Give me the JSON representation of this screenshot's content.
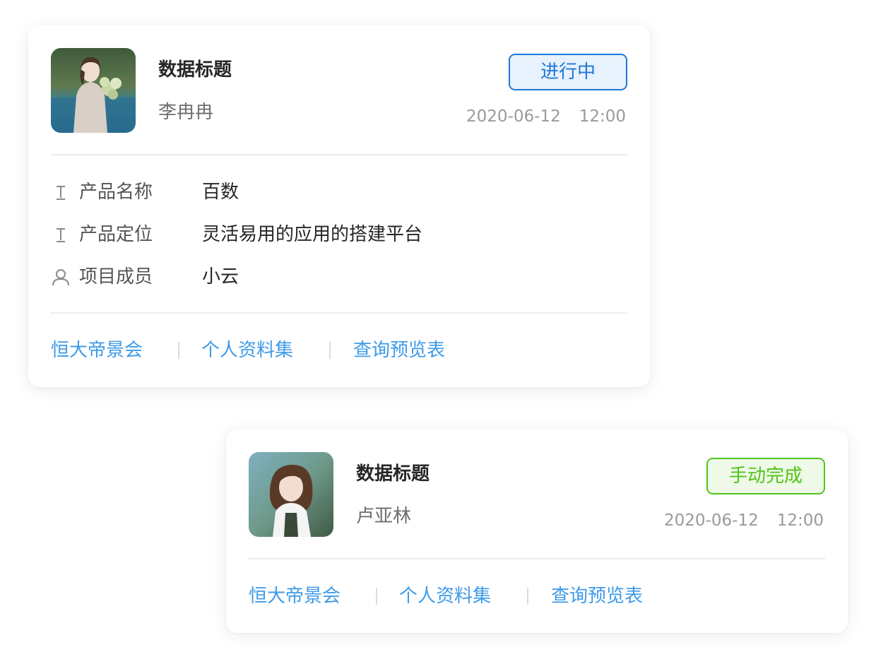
{
  "cards": [
    {
      "title": "数据标题",
      "person": "李冉冉",
      "status": {
        "label": "进行中",
        "color": "#1f77d6"
      },
      "date": "2020-06-12",
      "time": "12:00",
      "fields": [
        {
          "icon": "text-type-icon",
          "label": "产品名称",
          "value": "百数"
        },
        {
          "icon": "text-type-icon",
          "label": "产品定位",
          "value": "灵活易用的应用的搭建平台"
        },
        {
          "icon": "user-icon",
          "label": "项目成员",
          "value": "小云"
        }
      ],
      "links": [
        "恒大帝景会",
        "个人资料集",
        "查询预览表"
      ]
    },
    {
      "title": "数据标题",
      "person": "卢亚林",
      "status": {
        "label": "手动完成",
        "color": "#52c41a"
      },
      "date": "2020-06-12",
      "time": "12:00",
      "links": [
        "恒大帝景会",
        "个人资料集",
        "查询预览表"
      ]
    }
  ]
}
